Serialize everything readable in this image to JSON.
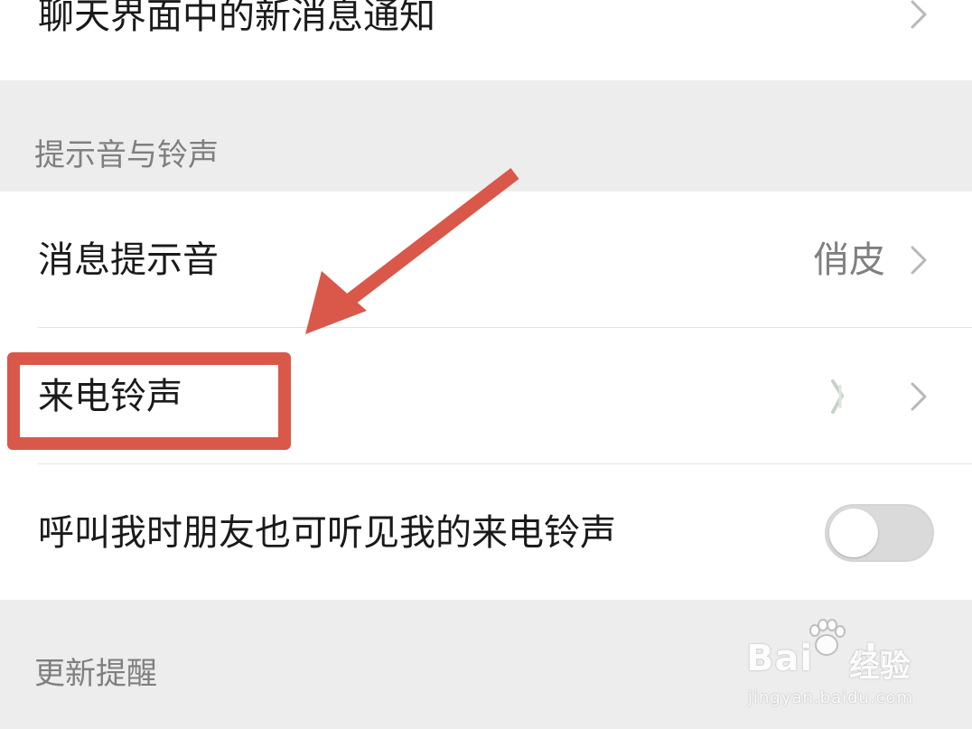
{
  "settings": {
    "rows": {
      "chat_notifications": {
        "label": "聊天界面中的新消息通知"
      },
      "message_tone": {
        "label": "消息提示音",
        "value": "俏皮"
      },
      "ringtone": {
        "label": "来电铃声"
      },
      "friends_hear_ringtone": {
        "label": "呼叫我时朋友也可听见我的来电铃声",
        "enabled": false
      }
    },
    "sections": {
      "tones_header": "提示音与铃声",
      "update_header": "更新提醒"
    }
  },
  "annotation": {
    "color": "#d9584a"
  },
  "watermark": {
    "brand": "Bai",
    "brand_tail": "du",
    "subtitle": "经验",
    "url": "jingyan.baidu.com"
  },
  "colors": {
    "background": "#ededed",
    "card": "#ffffff",
    "text": "#1a1a1a",
    "secondary_text": "#808080",
    "toggle_off": "#dadada"
  },
  "icons": {
    "chevron": "chevron-right-icon"
  }
}
